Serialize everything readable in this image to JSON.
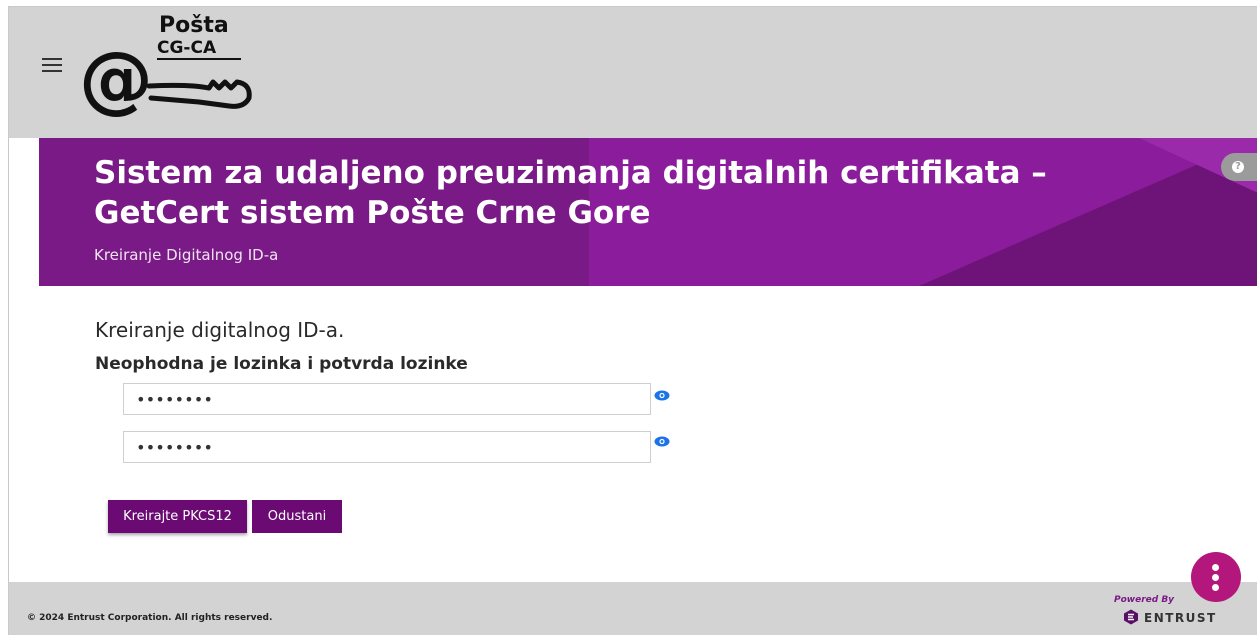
{
  "header": {
    "menu_icon": "hamburger-menu-icon",
    "logo_line1": "Pošta",
    "logo_line2": "CG-CA"
  },
  "banner": {
    "title": "Sistem za udaljeno preuzimanja digitalnih certifikata – GetCert sistem Pošte Crne Gore",
    "subtitle": "Kreiranje Digitalnog ID-a",
    "help_icon": "question-circle-icon"
  },
  "form": {
    "heading": "Kreiranje digitalnog ID-a.",
    "subheading": "Neophodna je lozinka i potvrda lozinke",
    "password_value": "••••••••",
    "confirm_value": "••••••••",
    "eye_icon": "eye-icon",
    "create_button": "Kreirajte PKCS12",
    "cancel_button": "Odustani"
  },
  "footer": {
    "copyright": "© 2024 Entrust Corporation. All rights reserved.",
    "powered_by": "Powered By",
    "brand": "ENTRUST"
  },
  "colors": {
    "banner": "#7a1a86",
    "button": "#6b0a73",
    "fab": "#b3177b",
    "topbar": "#d3d3d3"
  }
}
